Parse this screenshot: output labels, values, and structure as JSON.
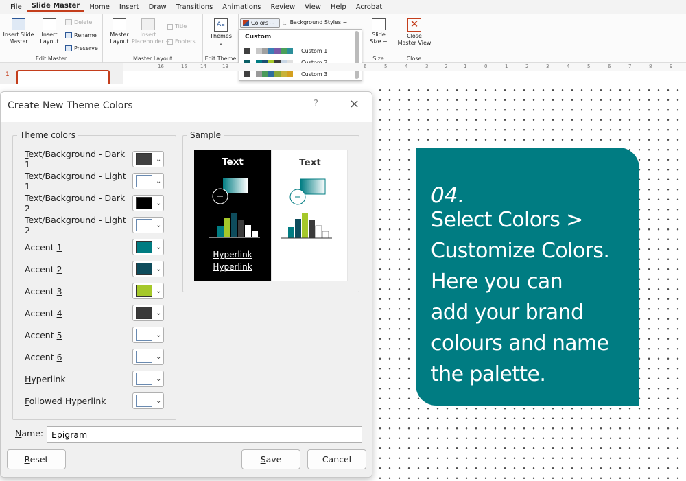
{
  "menubar": {
    "items": [
      "File",
      "Slide Master",
      "Home",
      "Insert",
      "Draw",
      "Transitions",
      "Animations",
      "Review",
      "View",
      "Help",
      "Acrobat"
    ],
    "active": "Slide Master"
  },
  "ribbon": {
    "edit_master": {
      "label": "Edit Master",
      "insert_slide_master": "Insert Slide\nMaster",
      "insert_layout": "Insert\nLayout",
      "delete": "Delete",
      "rename": "Rename",
      "preserve": "Preserve"
    },
    "master_layout": {
      "label": "Master Layout",
      "master_layout": "Master\nLayout",
      "insert_placeholder": "Insert\nPlaceholder ~",
      "title": "Title",
      "footers": "Footers"
    },
    "edit_theme": {
      "label": "Edit Theme",
      "themes": "Themes"
    },
    "colors_button": "Colors ~",
    "background_styles": "Background Styles ~",
    "size": {
      "label": "Size",
      "slide_size": "Slide\nSize ~"
    },
    "close": {
      "label": "Close",
      "close_master_view": "Close\nMaster View"
    }
  },
  "colors_dropdown": {
    "section": "Custom",
    "items": [
      {
        "name": "Custom 1",
        "swatches": [
          "#404040",
          "#ffffff",
          "#c8c8c8",
          "#a0a0a0",
          "#3a7fb5",
          "#7a5aa8",
          "#4aa05a",
          "#2c8f9a"
        ]
      },
      {
        "name": "Custom 2",
        "swatches": [
          "#0a5e65",
          "#ffffff",
          "#007c82",
          "#1b4f72",
          "#a5c82a",
          "#3a3a3a",
          "#c8d6e5",
          "#e0e0e0"
        ]
      },
      {
        "name": "Custom 3",
        "swatches": [
          "#404040",
          "#ffffff",
          "#9a9a9a",
          "#4a9a5a",
          "#2e6e9e",
          "#8aa83a",
          "#c8b23a",
          "#d4a020"
        ]
      }
    ]
  },
  "ruler": {
    "ticks": [
      "16",
      "15",
      "14",
      "13",
      "6",
      "5",
      "4",
      "3",
      "2",
      "1",
      "0",
      "1",
      "2",
      "3",
      "4",
      "5",
      "6",
      "7",
      "8",
      "9"
    ]
  },
  "thumbnail": {
    "number": "1"
  },
  "dialog": {
    "title": "Create New Theme Colors",
    "help": "?",
    "close": "×",
    "theme_colors_legend": "Theme colors",
    "sample_legend": "Sample",
    "rows": [
      {
        "label": "Text/Background - Dark 1",
        "ak": 0,
        "color": "#404040"
      },
      {
        "label": "Text/Background - Light 1",
        "ak": 5,
        "color": "#ffffff"
      },
      {
        "label": "Text/Background - Dark 2",
        "ak": 18,
        "color": "#000000"
      },
      {
        "label": "Text/Background - Light 2",
        "ak": 18,
        "color": "#ffffff"
      },
      {
        "label": "Accent 1",
        "ak": 7,
        "color": "#007c82"
      },
      {
        "label": "Accent 2",
        "ak": 7,
        "color": "#0e4c5c"
      },
      {
        "label": "Accent 3",
        "ak": 7,
        "color": "#a5c82a"
      },
      {
        "label": "Accent 4",
        "ak": 7,
        "color": "#3a3a3a"
      },
      {
        "label": "Accent 5",
        "ak": 7,
        "color": "#ffffff"
      },
      {
        "label": "Accent 6",
        "ak": 7,
        "color": "#ffffff"
      },
      {
        "label": "Hyperlink",
        "ak": 0,
        "color": "#ffffff"
      },
      {
        "label": "Followed Hyperlink",
        "ak": 0,
        "color": "#ffffff"
      }
    ],
    "sample": {
      "text_dark": "Text",
      "text_light": "Text",
      "hyperlink": "Hyperlink",
      "followed_hyperlink": "Hyperlink"
    },
    "name_label": "Name:",
    "name_ak": 0,
    "name_value": "Epigram",
    "reset": "Reset",
    "save": "Save",
    "cancel": "Cancel"
  },
  "card": {
    "number": "04.",
    "lines": [
      "Select Colors >",
      "Customize Colors.",
      "Here you can",
      "add your brand",
      "colours and name",
      "the palette."
    ],
    "color": "#007c82"
  }
}
